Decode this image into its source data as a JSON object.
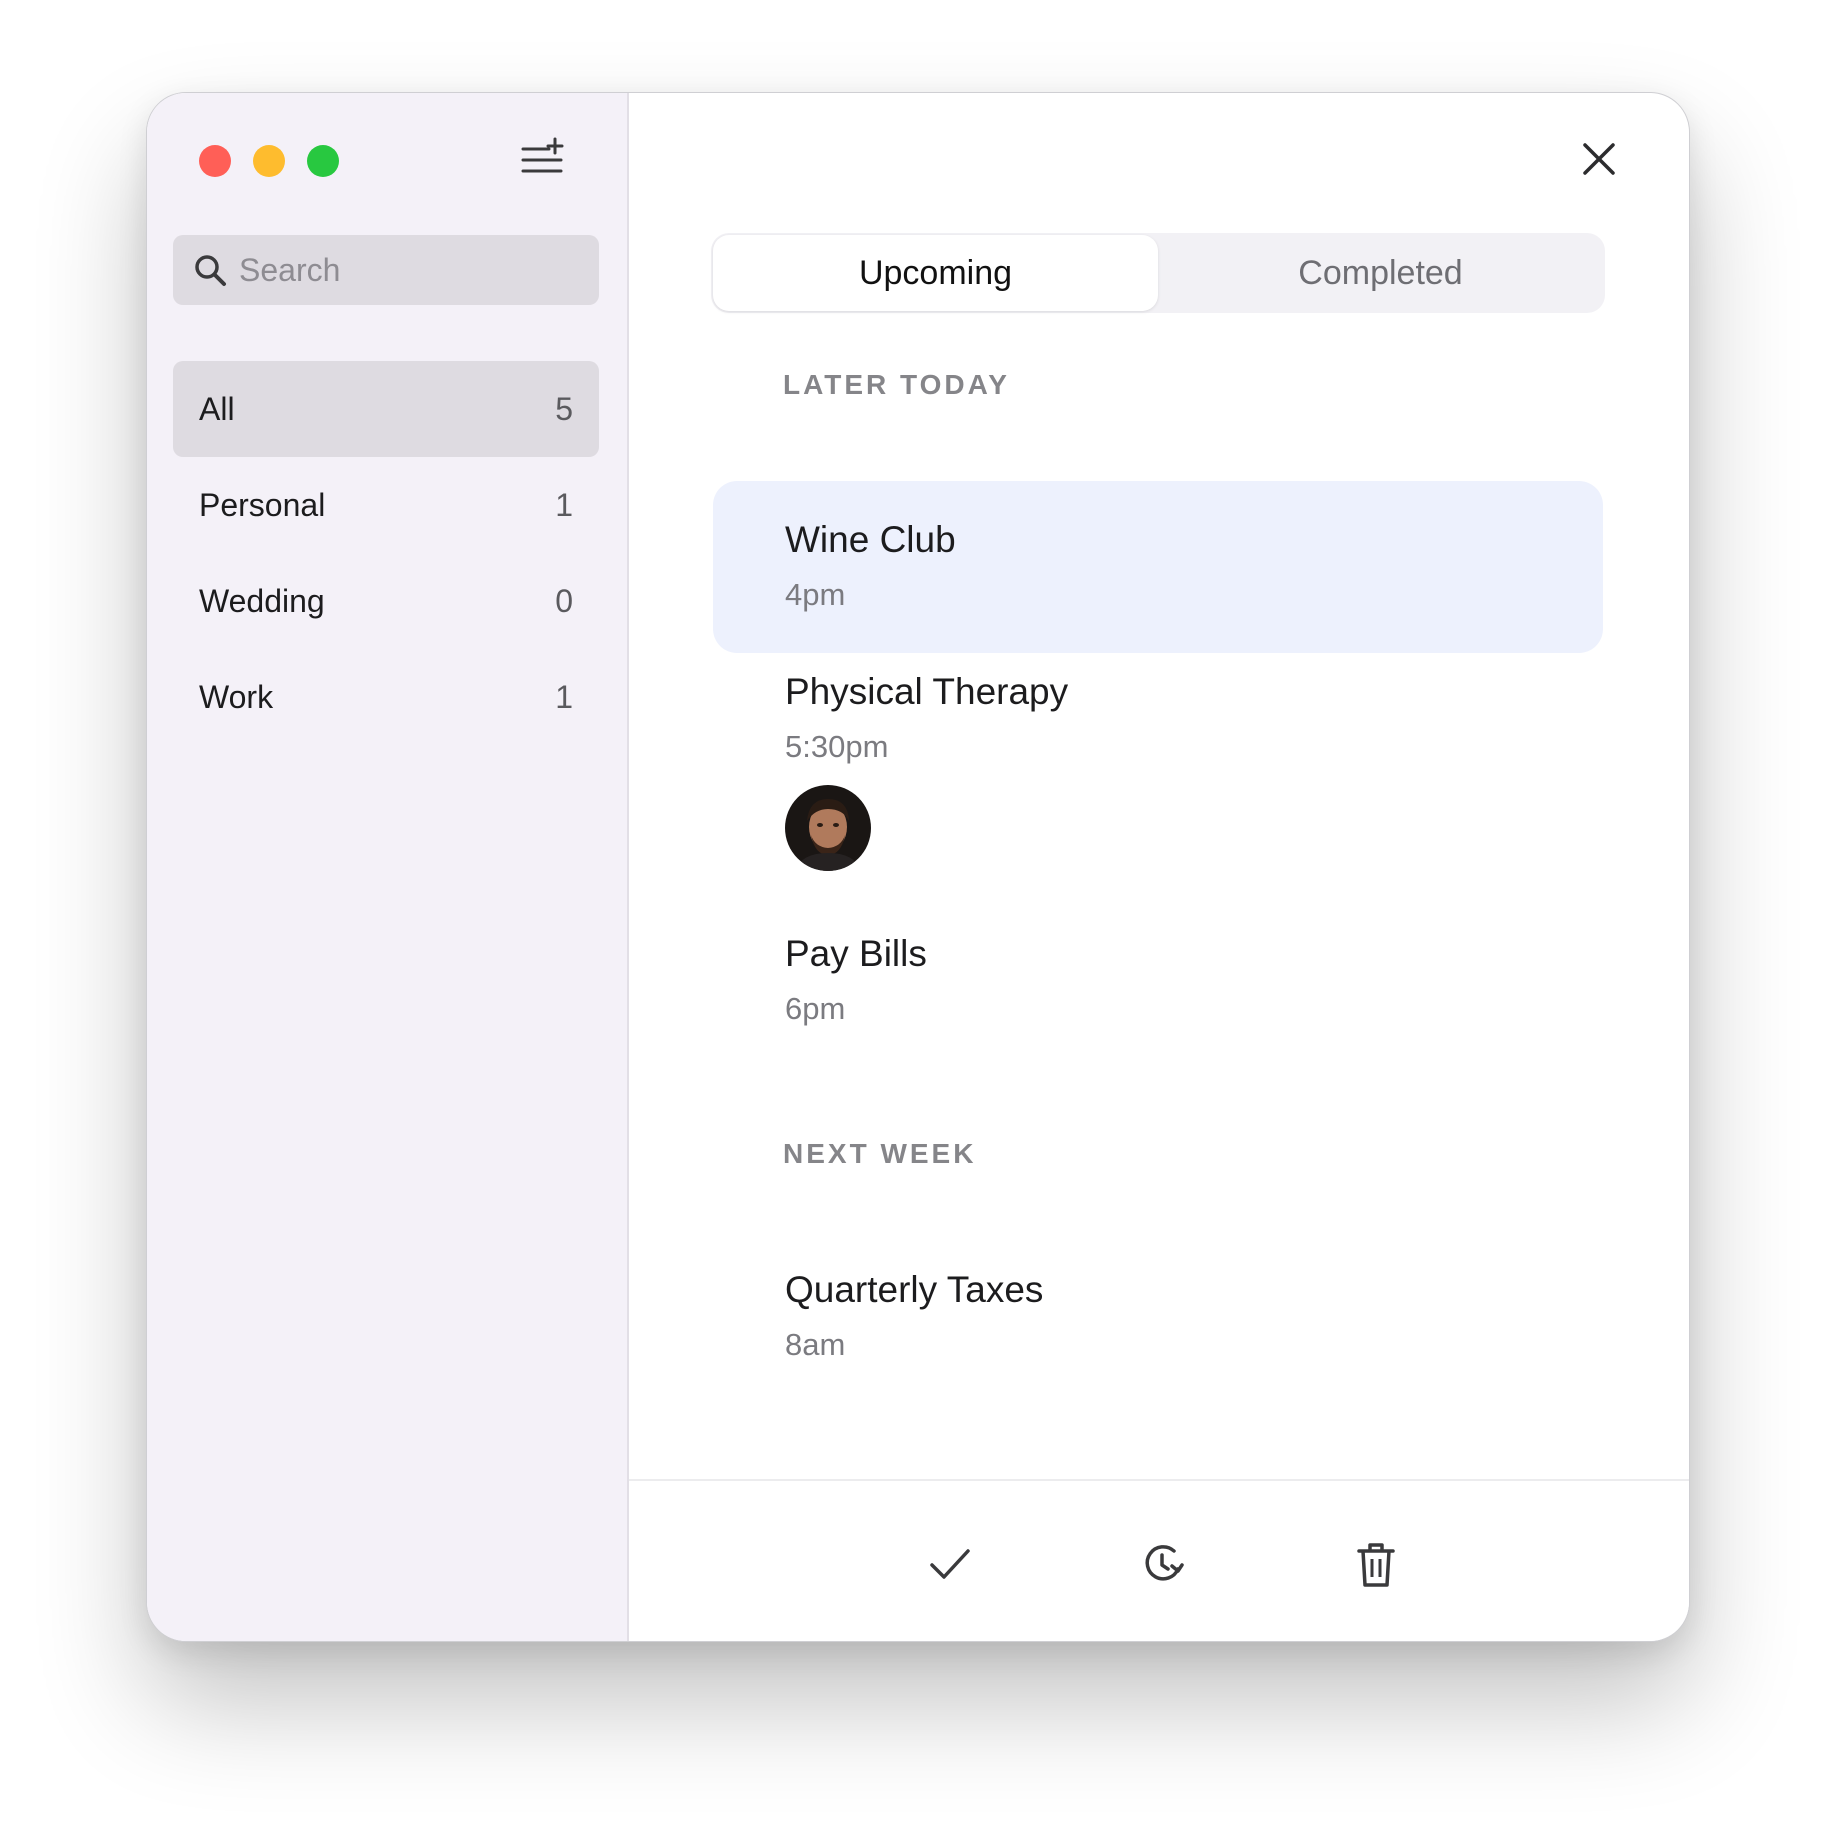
{
  "sidebar": {
    "search_placeholder": "Search",
    "lists": [
      {
        "label": "All",
        "count": "5"
      },
      {
        "label": "Personal",
        "count": "1"
      },
      {
        "label": "Wedding",
        "count": "0"
      },
      {
        "label": "Work",
        "count": "1"
      }
    ]
  },
  "tabs": {
    "upcoming": "Upcoming",
    "completed": "Completed"
  },
  "sections": {
    "later_today": {
      "header": "LATER TODAY",
      "items": [
        {
          "title": "Wine Club",
          "time": "4pm"
        },
        {
          "title": "Physical Therapy",
          "time": "5:30pm"
        },
        {
          "title": "Pay Bills",
          "time": "6pm"
        }
      ]
    },
    "next_week": {
      "header": "NEXT WEEK",
      "items": [
        {
          "title": "Quarterly Taxes",
          "time": "8am"
        }
      ]
    }
  },
  "colors": {
    "close": "#ff5f57",
    "minimize": "#febc2e",
    "zoom": "#28c840",
    "selected_row": "#edf1fd",
    "sidebar_bg": "#f4f1f8"
  },
  "icons": [
    "search-icon",
    "add-list-icon",
    "close-icon",
    "checkmark-icon",
    "reschedule-icon",
    "trash-icon"
  ]
}
